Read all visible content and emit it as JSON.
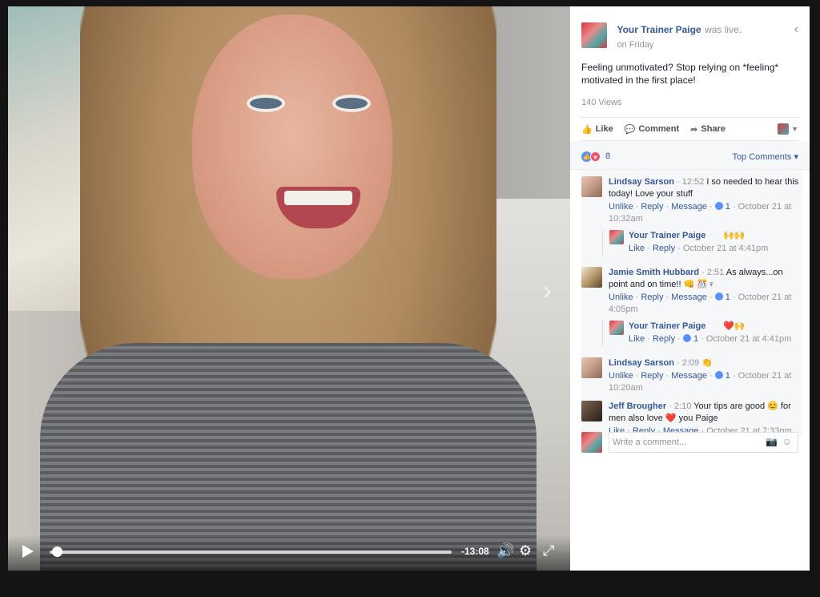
{
  "video": {
    "time_remaining": "-13:08",
    "progress": 0.01
  },
  "post": {
    "page_name": "Your Trainer Paige",
    "was_live": "was live.",
    "when": "on Friday",
    "text": "Feeling unmotivated? Stop relying on *feeling* motivated in the first place!",
    "views": "140 Views"
  },
  "actions": {
    "like": "Like",
    "comment": "Comment",
    "share": "Share"
  },
  "reactions": {
    "count": "8",
    "sort_label": "Top Comments"
  },
  "comments": [
    {
      "name": "Lindsay Sarson",
      "stamp": "12:52",
      "text": "I so needed to hear this today! Love your stuff",
      "actions": [
        "Unlike",
        "Reply",
        "Message"
      ],
      "likes": "1",
      "date": "October 21 at 10:32am",
      "reply": {
        "name": "Your Trainer Paige",
        "emoji": "🙌🙌",
        "actions": [
          "Like",
          "Reply"
        ],
        "date": "October 21 at 4:41pm"
      }
    },
    {
      "name": "Jamie Smith Hubbard",
      "stamp": "2:51",
      "text": "As always...on point and on time!! 👊 🎊♀",
      "actions": [
        "Unlike",
        "Reply",
        "Message"
      ],
      "likes": "1",
      "date": "October 21 at 4:05pm",
      "reply": {
        "name": "Your Trainer Paige",
        "emoji": "❤️🙌",
        "actions": [
          "Like",
          "Reply"
        ],
        "likes": "1",
        "date": "October 21 at 4:41pm"
      }
    },
    {
      "name": "Lindsay Sarson",
      "stamp": "2:09",
      "text": "👏",
      "actions": [
        "Unlike",
        "Reply",
        "Message"
      ],
      "likes": "1",
      "date": "October 21 at 10:20am"
    },
    {
      "name": "Jeff Brougher",
      "stamp": "2:10",
      "text": "Your tips are good 😊 for men also love ❤️ you Paige",
      "actions": [
        "Like",
        "Reply",
        "Message"
      ],
      "date": "October 21 at 7:33pm"
    }
  ],
  "composer": {
    "placeholder": "Write a comment..."
  }
}
